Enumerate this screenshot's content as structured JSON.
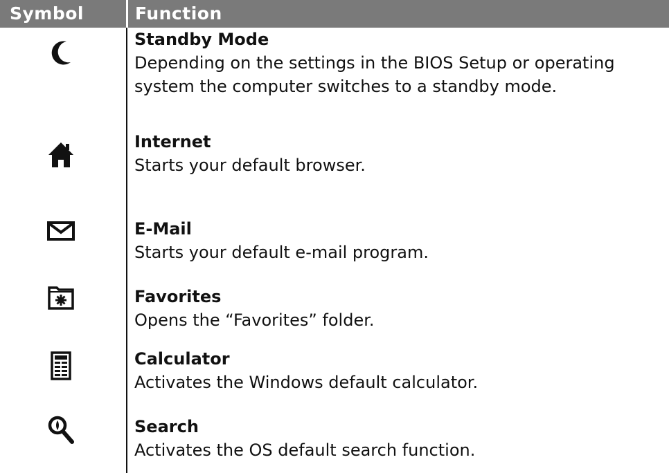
{
  "header": {
    "symbol": "Symbol",
    "function": "Function"
  },
  "rows": [
    {
      "icon": "crescent-moon-icon",
      "title": "Standby Mode",
      "description": "Depending on the settings in the BIOS Setup or operating system the computer switches to a standby mode."
    },
    {
      "icon": "house-icon",
      "title": "Internet",
      "description": "Starts your default browser."
    },
    {
      "icon": "envelope-icon",
      "title": "E-Mail",
      "description": "Starts your default e-mail program."
    },
    {
      "icon": "favorites-folder-icon",
      "title": "Favorites",
      "description": "Opens the “Favorites” folder."
    },
    {
      "icon": "calculator-icon",
      "title": "Calculator",
      "description": "Activates the Windows default calculator."
    },
    {
      "icon": "magnifier-icon",
      "title": "Search",
      "description": "Activates the OS default search function."
    }
  ],
  "colors": {
    "header_bg": "#7a7a7a",
    "header_text": "#ffffff",
    "text": "#111111"
  }
}
